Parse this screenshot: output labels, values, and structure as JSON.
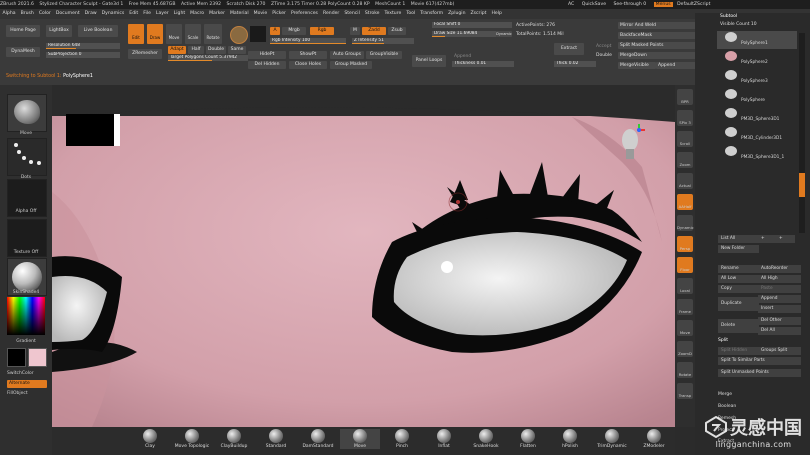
{
  "titlebar": {
    "app": "ZBrush 2021.6",
    "doc": "Stylized Character Sculpt - Gate3d 1",
    "free_mem": "Free Mem 45.687GB",
    "active_mem": "Active Mem 2392",
    "scratch": "Scratch Disk 270",
    "ztime": "ZTime 3.175 Timer 0.28 PolyCount 0.28 KP",
    "meshcount": "MeshCount 1",
    "movie": "Movie 617(427mb)",
    "ac": "AC",
    "quicksave": "QuickSave",
    "see_through": "See-through 0",
    "menus": "Menus",
    "script": "DefaultZScript"
  },
  "menu": [
    "Alpha",
    "Brush",
    "Color",
    "Document",
    "Draw",
    "Dynamics",
    "Edit",
    "File",
    "Layer",
    "Light",
    "Macro",
    "Marker",
    "Material",
    "Movie",
    "Picker",
    "Preferences",
    "Render",
    "Stencil",
    "Stroke",
    "Texture",
    "Tool",
    "Transform",
    "Zplugin",
    "Zscript",
    "Help"
  ],
  "toolbar": {
    "home_page": "Home Page",
    "lightbox": "LightBox",
    "live_boolean": "Live Boolean",
    "dynamesh": "DynaMesh",
    "resolution": "Resolution 648",
    "subprojection": "SubProjection 0",
    "edit": "Edit",
    "draw": "Draw",
    "move": "Move",
    "scale": "Scale",
    "rotate": "Rotate",
    "zremesher": "ZRemesher",
    "adapt": "Adapt",
    "half": "Half",
    "double": "Double",
    "same": "Same",
    "target_polys": "Target Polygons Count 5.37942",
    "a": "A",
    "mrgb": "Mrgb",
    "rgb": "Rgb",
    "rgb_intensity": "Rgb Intensity 100",
    "m": "M",
    "zadd": "Zadd",
    "zsub": "Zsub",
    "z_intensity": "Z Intensity 51",
    "hidept": "HidePt",
    "showpt": "ShowPt",
    "del_hidden": "Del Hidden",
    "close_holes": "Close Holes",
    "auto_groups": "Auto Groups",
    "group_visible": "GroupVisible",
    "group_masked": "Group Masked",
    "focal_shift": "Focal Shift 0",
    "draw_size": "Draw Size 11.69084",
    "dynamic": "Dynamic",
    "active_points": "ActivePoints: 276",
    "total_points": "TotalPoints: 1.514 Mil",
    "panel_loops": "Panel Loops",
    "append": "Append",
    "thickness": "Thickness 0.01",
    "extract": "Extract",
    "accept": "Accept",
    "double2": "Double",
    "thick": "Thick 0.02",
    "mirror_weld": "Mirror And Weld",
    "backface_mask": "BackfaceMask",
    "split_masked": "Split Masked Points",
    "merge_down": "MergeDown",
    "merge_visible": "MergeVisible",
    "append2": "Append"
  },
  "status": {
    "prefix": "Switching to Subtool 1:",
    "name": "PolySphere1"
  },
  "left": {
    "brush": "Move",
    "stroke": "Dots",
    "alpha": "Alpha Off",
    "texture": "Texture Off",
    "material": "SkinShade4",
    "gradient": "Gradient",
    "switch_color": "SwitchColor",
    "alternate": "Alternate",
    "fill_object": "FillObject"
  },
  "rightstrip": [
    "BPR",
    "SPix 3",
    "Scroll",
    "Zoom",
    "Actual",
    "AAHalf",
    "Dynamic",
    "Persp",
    "Floor",
    "Local",
    "Frame",
    "Move",
    "ZoomD",
    "Rotate",
    "Transp"
  ],
  "subtool": {
    "title": "Subtool",
    "visible_count": "Visible Count 10",
    "items": [
      "PolySphere1",
      "PolySphere2",
      "PolySphere3",
      "PolySphere",
      "PM3D_Sphere3D1",
      "PM3D_Cylinder3D1",
      "PM3D_Sphere3D1_1"
    ],
    "list_all": "List All",
    "new_folder": "New Folder",
    "rename": "Rename",
    "auto_reorder": "AutoReorder",
    "all_low": "All Low",
    "all_high": "All High",
    "copy": "Copy",
    "paste": "Paste",
    "duplicate": "Duplicate",
    "append": "Append",
    "insert": "Insert",
    "delete": "Delete",
    "del_other": "Del Other",
    "del_all": "Del All",
    "split": "Split",
    "split_hidden": "Split Hidden",
    "groups_split": "Groups Split",
    "split_similar": "Split To Similar Parts",
    "split_unmasked": "Split Unmasked Points",
    "merge": "Merge",
    "boolean": "Boolean",
    "remesh": "Remesh",
    "project": "Project",
    "extract": "Extract"
  },
  "brushes": [
    "Clay",
    "Move Topologic",
    "ClayBuildup",
    "Standard",
    "DamStandard",
    "Move",
    "Pinch",
    "Inflat",
    "SnakeHook",
    "Flatten",
    "hPolish",
    "TrimDynamic",
    "ZModeler"
  ],
  "watermark": {
    "cn": "灵感中国",
    "url": "lingganchina.com"
  },
  "colors": {
    "accent": "#e07a1f",
    "skin": "#d7a7b0",
    "liner": "#0a0a0a",
    "panel": "#2a2a2a"
  }
}
